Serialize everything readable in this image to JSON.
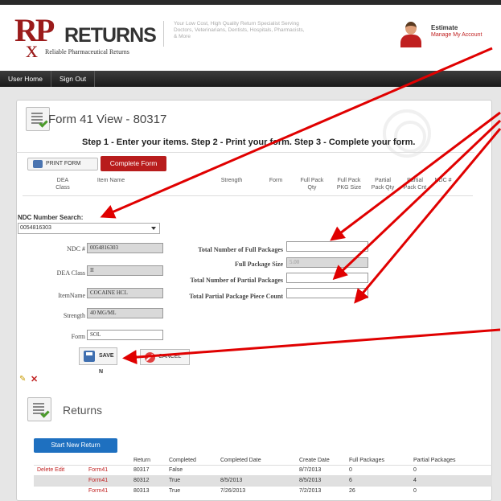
{
  "header": {
    "logo_rp": "RP",
    "logo_x": "x",
    "logo_returns": "RETURNS",
    "logo_subtitle": "Reliable Pharmaceutical Returns",
    "tagline": "Your Low Cost, High Quality Return Specialist Serving Doctors, Veterinarians, Dentists, Hospitals, Pharmacists, & More",
    "user_name": "Estimate",
    "manage_account": "Manage My Account"
  },
  "nav": {
    "items": [
      "User Home",
      "Sign Out"
    ]
  },
  "form": {
    "title": "Form 41 View - 80317",
    "steps": "Step 1 - Enter your items. Step 2 - Print your form. Step 3 - Complete your form.",
    "print_button": "PRINT FORM",
    "complete_button": "Complete Form",
    "columns": [
      "DEA Class",
      "Item Name",
      "Strength",
      "Form",
      "Full Pack Qty",
      "Full Pack PKG Size",
      "Partial Pack Qty",
      "Partial Pack Cnt",
      "NDC #"
    ],
    "ndc_search_label": "NDC Number Search:",
    "ndc_search_value": "0054816303",
    "fields": {
      "ndc": {
        "label": "NDC #",
        "value": "0054816303"
      },
      "dea_class": {
        "label": "DEA Class",
        "value": "II"
      },
      "item_name": {
        "label": "ItemName",
        "value": "COCAINE HCL"
      },
      "strength": {
        "label": "Strength",
        "value": "40 MG/ML"
      },
      "form": {
        "label": "Form",
        "value": "SOL"
      },
      "total_full_packages": {
        "label": "Total Number of Full Packages",
        "value": ""
      },
      "full_package_size": {
        "label": "Full Package Size",
        "value": "5.00"
      },
      "total_partial_packages": {
        "label": "Total Number of Partial Packages",
        "value": ""
      },
      "total_partial_piece_count": {
        "label": "Total Partial Package Piece Count",
        "value": ""
      }
    },
    "save_button": "SAVE N",
    "cancel_button": "CANCEL"
  },
  "returns": {
    "title": "Returns",
    "new_button": "Start New Return",
    "columns": [
      "",
      "",
      "Return",
      "Completed",
      "Completed Date",
      "Create Date",
      "Full Packages",
      "Partial Packages"
    ],
    "rows": [
      {
        "actions": "Delete Edit",
        "form": "Form41",
        "return": "80317",
        "completed": "False",
        "completed_date": "",
        "create_date": "8/7/2013",
        "full": "0",
        "partial": "0"
      },
      {
        "actions": "",
        "form": "Form41",
        "return": "80312",
        "completed": "True",
        "completed_date": "8/5/2013",
        "create_date": "8/5/2013",
        "full": "6",
        "partial": "4"
      },
      {
        "actions": "",
        "form": "Form41",
        "return": "80313",
        "completed": "True",
        "completed_date": "7/26/2013",
        "create_date": "7/2/2013",
        "full": "26",
        "partial": "0"
      }
    ]
  },
  "colors": {
    "brand_red": "#b81c1c",
    "accent_blue": "#1e70c0",
    "annotation_red": "#e00000"
  }
}
